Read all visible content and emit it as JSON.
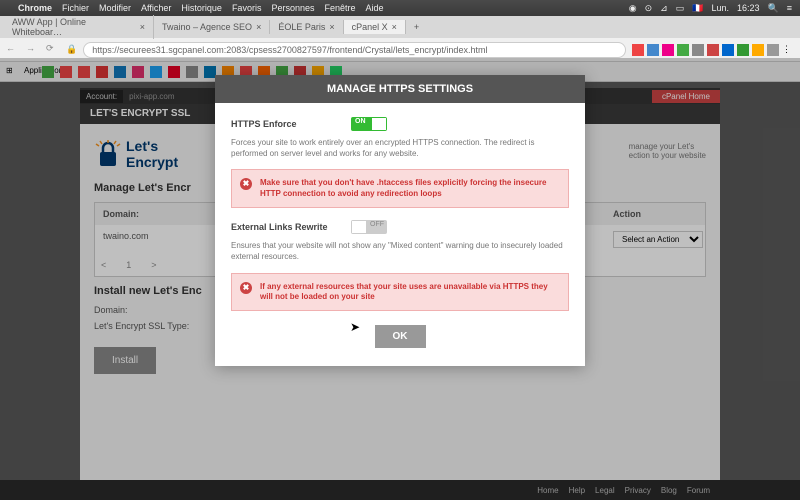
{
  "menubar": {
    "items": [
      "Chrome",
      "Fichier",
      "Modifier",
      "Afficher",
      "Historique",
      "Favoris",
      "Personnes",
      "Fenêtre",
      "Aide"
    ],
    "right": {
      "flag": "🇫🇷",
      "day": "Lun.",
      "time": "16:23"
    }
  },
  "tabs": [
    {
      "label": "AWW App | Online Whiteboar…"
    },
    {
      "label": "Twaino – Agence SEO"
    },
    {
      "label": "ÉOLE Paris"
    },
    {
      "label": "cPanel X",
      "active": true
    }
  ],
  "url": "https://securees31.sgcpanel.com:2083/cpsess2700827597/frontend/Crystal/lets_encrypt/index.html",
  "bookmarks": {
    "label": "Applications"
  },
  "account": {
    "label": "Account:",
    "value": "pixi-app.com",
    "home": "cPanel Home"
  },
  "header": "LET'S ENCRYPT SSL",
  "logo": {
    "lets": "Let's",
    "encrypt": "Encrypt"
  },
  "section1": "Manage Let's Encr",
  "table": {
    "col1": "Domain:",
    "col2": "Action",
    "row1": "twaino.com",
    "select": "Select an Action"
  },
  "pager": {
    "prev": "<",
    "page": "1",
    "next": ">"
  },
  "section2": "Install new Let's Enc",
  "fields": {
    "domain": "Domain:",
    "type": "Let's Encrypt SSL Type:"
  },
  "installBtn": "Install",
  "modal": {
    "title": "MANAGE HTTPS SETTINGS",
    "httpsEnforce": "HTTPS Enforce",
    "desc1": "Forces your site to work entirely over an encrypted HTTPS connection. The redirect is performed on server level and works for any website.",
    "warn1": "Make sure that you don't have .htaccess files explicitly forcing the insecure HTTP connection to avoid any redirection loops",
    "extRewrite": "External Links Rewrite",
    "desc2": "Ensures that your website will not show any \"Mixed content\" warning due to insecurely loaded external resources.",
    "warn2": "If any external resources that your site uses are unavailable via HTTPS they will not be loaded on your site",
    "ok": "OK"
  },
  "sidetext": {
    "l1": "manage your Let's",
    "l2": "ection to your website"
  },
  "footer": [
    "Home",
    "Help",
    "Legal",
    "Privacy",
    "Blog",
    "Forum"
  ]
}
